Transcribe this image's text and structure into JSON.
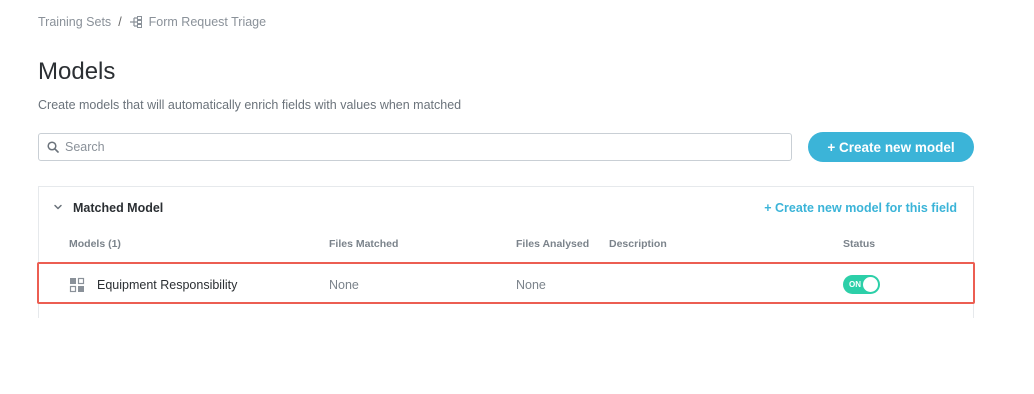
{
  "breadcrumb": {
    "root": "Training Sets",
    "separator": "/",
    "current": "Form Request Triage",
    "current_icon": "tree-icon"
  },
  "page": {
    "title": "Models",
    "subtitle": "Create models that will automatically enrich fields with values when matched"
  },
  "search": {
    "placeholder": "Search",
    "value": "",
    "icon": "search-icon"
  },
  "create_button": {
    "label": "+ Create new model",
    "color": "#3bb4d8"
  },
  "section": {
    "title": "Matched Model",
    "collapse_icon": "chevron-down-icon",
    "create_link": "+ Create new model for this field",
    "columns": [
      "Models (1)",
      "Files Matched",
      "Files Analysed",
      "Description",
      "Status"
    ],
    "rows": [
      {
        "name": "Equipment Responsibility",
        "icon": "model-grid-icon",
        "files_matched": "None",
        "files_analysed": "None",
        "description": "",
        "status_label": "ON",
        "status_on": true,
        "highlighted": true
      }
    ]
  },
  "colors": {
    "accent": "#3bb4d8",
    "toggle_on": "#2ccfa8",
    "highlight": "#ec5e52"
  }
}
